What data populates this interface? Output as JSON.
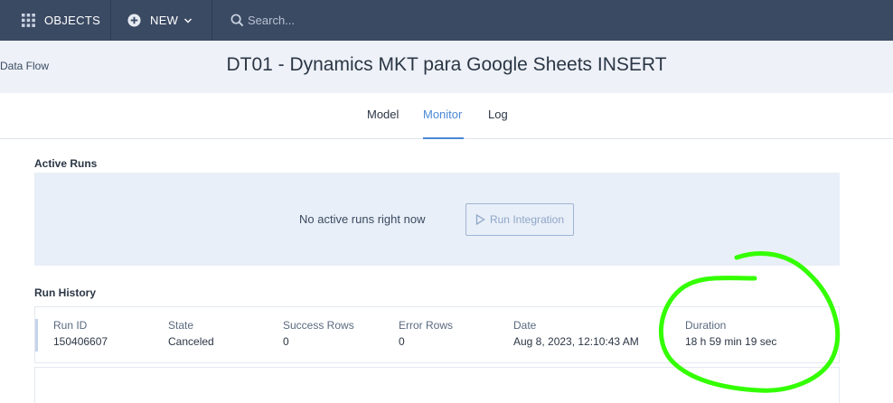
{
  "nav": {
    "objects_label": "OBJECTS",
    "new_label": "NEW",
    "search_placeholder": "Search..."
  },
  "header": {
    "breadcrumb": "Data Flow",
    "title": "DT01 - Dynamics MKT para Google Sheets INSERT"
  },
  "tabs": [
    {
      "label": "Model",
      "active": false
    },
    {
      "label": "Monitor",
      "active": true
    },
    {
      "label": "Log",
      "active": false
    }
  ],
  "active_runs": {
    "heading": "Active Runs",
    "empty_text": "No active runs right now",
    "run_button_label": "Run Integration"
  },
  "run_history": {
    "heading": "Run History",
    "columns": [
      "Run ID",
      "State",
      "Success Rows",
      "Error Rows",
      "Date",
      "Duration"
    ],
    "rows": [
      {
        "run_id": "150406607",
        "state": "Canceled",
        "success_rows": "0",
        "error_rows": "0",
        "date": "Aug 8, 2023, 12:10:43 AM",
        "duration": "18 h 59 min 19 sec"
      }
    ]
  },
  "colors": {
    "nav_bg": "#3b4a63",
    "accent": "#4a88d6",
    "annotation": "#33ff00"
  }
}
